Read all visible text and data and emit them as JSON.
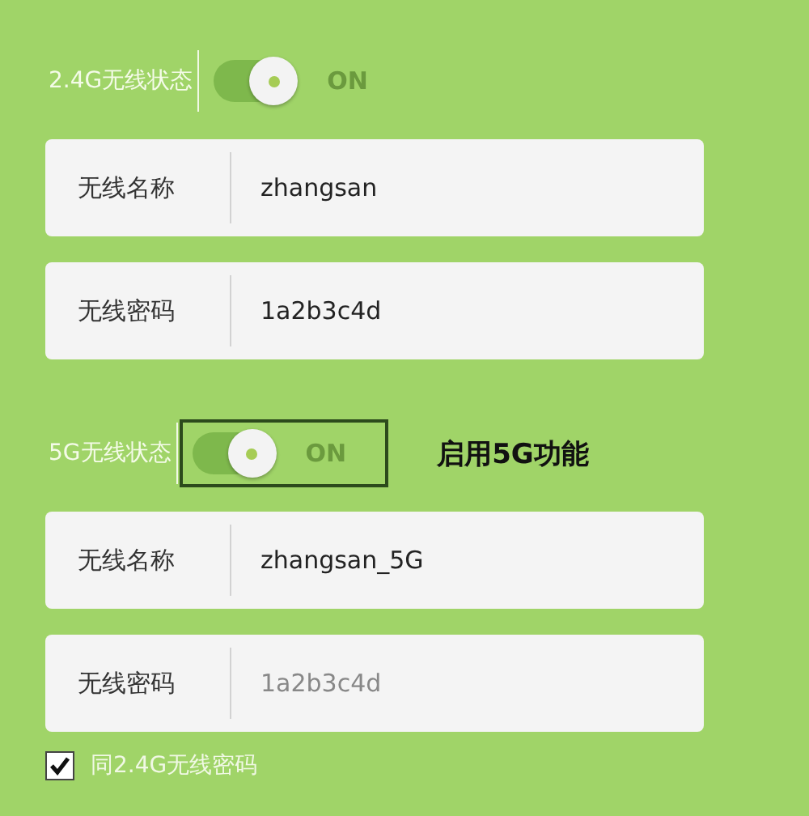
{
  "sections": [
    {
      "status_label": "2.4G无线状态",
      "toggle": {
        "on": true,
        "text": "ON",
        "highlighted": false
      },
      "fields": [
        {
          "label": "无线名称",
          "value": "zhangsan",
          "disabled": false
        },
        {
          "label": "无线密码",
          "value": "1a2b3c4d",
          "disabled": false
        }
      ]
    },
    {
      "status_label": "5G无线状态",
      "toggle": {
        "on": true,
        "text": "ON",
        "highlighted": true
      },
      "annotation": "启用5G功能",
      "fields": [
        {
          "label": "无线名称",
          "value": "zhangsan_5G",
          "disabled": false
        },
        {
          "label": "无线密码",
          "value": "1a2b3c4d",
          "disabled": true
        }
      ]
    }
  ],
  "same_password": {
    "label": "同2.4G无线密码",
    "checked": true
  }
}
